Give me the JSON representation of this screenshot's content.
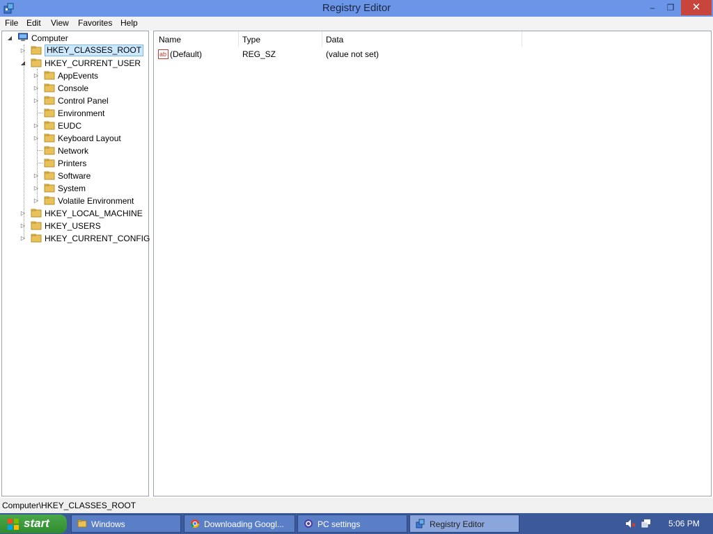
{
  "window": {
    "title": "Registry Editor",
    "minimize_icon": "–",
    "maximize_icon": "❐",
    "close_icon": "✕"
  },
  "menu": [
    "File",
    "Edit",
    "View",
    "Favorites",
    "Help"
  ],
  "tree": {
    "root": "Computer",
    "items": [
      {
        "label": "HKEY_CLASSES_ROOT",
        "expander": "▷",
        "selected": true
      },
      {
        "label": "HKEY_CURRENT_USER",
        "expander": "◢"
      },
      {
        "label": "AppEvents",
        "expander": "▷"
      },
      {
        "label": "Console",
        "expander": "▷"
      },
      {
        "label": "Control Panel",
        "expander": "▷"
      },
      {
        "label": "Environment",
        "expander": ""
      },
      {
        "label": "EUDC",
        "expander": "▷"
      },
      {
        "label": "Keyboard Layout",
        "expander": "▷"
      },
      {
        "label": "Network",
        "expander": ""
      },
      {
        "label": "Printers",
        "expander": ""
      },
      {
        "label": "Software",
        "expander": "▷"
      },
      {
        "label": "System",
        "expander": "▷"
      },
      {
        "label": "Volatile Environment",
        "expander": "▷"
      },
      {
        "label": "HKEY_LOCAL_MACHINE",
        "expander": "▷"
      },
      {
        "label": "HKEY_USERS",
        "expander": "▷"
      },
      {
        "label": "HKEY_CURRENT_CONFIG",
        "expander": "▷"
      }
    ]
  },
  "values": {
    "headers": [
      "Name",
      "Type",
      "Data"
    ],
    "rows": [
      {
        "icon": "ab",
        "name": "(Default)",
        "type": "REG_SZ",
        "data": "(value not set)"
      }
    ]
  },
  "status": "Computer\\HKEY_CLASSES_ROOT",
  "taskbar": {
    "start": "start",
    "tasks": [
      {
        "label": "Windows"
      },
      {
        "label": "Downloading Googl..."
      },
      {
        "label": "PC settings"
      },
      {
        "label": "Registry Editor"
      }
    ],
    "clock": "5:06 PM"
  },
  "colors": {
    "titlebar": "#6b96e8",
    "taskbar": "#3c5a9a",
    "start": "#2e8b2e",
    "selection": "#cce8ff",
    "folder": "#e8c15a"
  }
}
